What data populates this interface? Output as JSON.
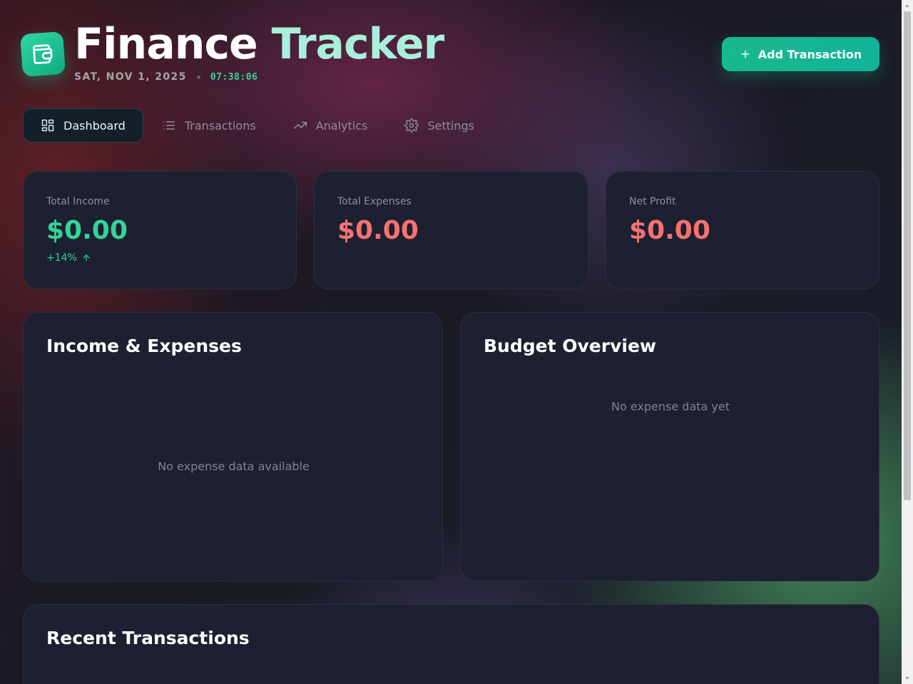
{
  "header": {
    "title_part1": "Finance ",
    "title_part2": "Tracker",
    "date": "SAT, NOV 1, 2025",
    "time": "07:38:06",
    "logo_icon": "wallet-icon",
    "add_button_label": "Add Transaction"
  },
  "nav": {
    "items": [
      {
        "label": "Dashboard",
        "icon": "grid-icon",
        "active": true
      },
      {
        "label": "Transactions",
        "icon": "list-icon",
        "active": false
      },
      {
        "label": "Analytics",
        "icon": "trending-up-icon",
        "active": false
      },
      {
        "label": "Settings",
        "icon": "gear-icon",
        "active": false
      }
    ]
  },
  "stats": {
    "income": {
      "label": "Total Income",
      "value": "$0.00",
      "trend": "+14%"
    },
    "expenses": {
      "label": "Total Expenses",
      "value": "$0.00"
    },
    "net": {
      "label": "Net Profit",
      "value": "$0.00"
    }
  },
  "panels": {
    "income_expenses": {
      "title": "Income & Expenses",
      "empty": "No expense data available"
    },
    "budget": {
      "title": "Budget Overview",
      "empty": "No expense data yet"
    },
    "recent": {
      "title": "Recent Transactions"
    }
  },
  "colors": {
    "accent": "#10b981",
    "positive": "#34d399",
    "negative": "#f87171",
    "card_bg": "#1c2030"
  }
}
